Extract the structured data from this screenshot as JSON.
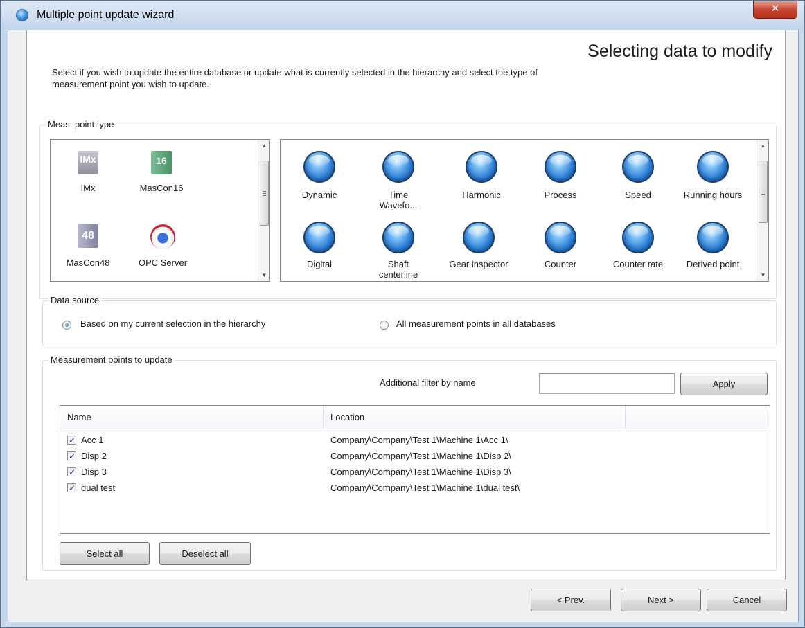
{
  "window": {
    "title": "Multiple point update wizard",
    "close_glyph": "✕"
  },
  "header": {
    "heading": "Selecting data to modify",
    "intro": "Select if you wish to update the entire database or update what is currently selected in the hierarchy and select the type of measurement point you wish to update."
  },
  "meas_point_type": {
    "label": "Meas. point type",
    "devices": [
      {
        "label": "IMx",
        "icon": "imx-icon",
        "glyph": "IMx"
      },
      {
        "label": "MasCon16",
        "icon": "mascon16-icon",
        "glyph": "16"
      },
      {
        "label": "MasCon48",
        "icon": "mascon48-icon",
        "glyph": "48"
      },
      {
        "label": "OPC Server",
        "icon": "opc-server-icon",
        "glyph": ""
      }
    ],
    "types": [
      {
        "label": "Dynamic",
        "icon": "point-orb-icon",
        "selected": true
      },
      {
        "label": "Time Wavefo...",
        "icon": "point-orb-icon"
      },
      {
        "label": "Harmonic",
        "icon": "point-orb-icon"
      },
      {
        "label": "Process",
        "icon": "point-orb-icon"
      },
      {
        "label": "Speed",
        "icon": "point-orb-icon"
      },
      {
        "label": "Running hours",
        "icon": "point-orb-icon"
      },
      {
        "label": "Digital",
        "icon": "point-orb-icon"
      },
      {
        "label": "Shaft centerline",
        "icon": "point-orb-icon"
      },
      {
        "label": "Gear inspector",
        "icon": "point-orb-icon"
      },
      {
        "label": "Counter",
        "icon": "point-orb-icon"
      },
      {
        "label": "Counter rate",
        "icon": "point-orb-icon"
      },
      {
        "label": "Derived point",
        "icon": "point-orb-icon"
      }
    ]
  },
  "data_source": {
    "label": "Data source",
    "options": [
      {
        "label": "Based on my current selection in the hierarchy",
        "checked": true
      },
      {
        "label": "All measurement points in all databases",
        "checked": false
      }
    ]
  },
  "measurement_points": {
    "label": "Measurement points to update",
    "filter_label": "Additional filter by name",
    "filter_value": "",
    "apply_label": "Apply",
    "columns": [
      "Name",
      "Location"
    ],
    "rows": [
      {
        "name": "Acc 1",
        "location": "Company\\Company\\Test 1\\Machine 1\\Acc 1\\",
        "checked": true
      },
      {
        "name": "Disp 2",
        "location": "Company\\Company\\Test 1\\Machine 1\\Disp 2\\",
        "checked": true
      },
      {
        "name": "Disp 3",
        "location": "Company\\Company\\Test 1\\Machine 1\\Disp 3\\",
        "checked": true
      },
      {
        "name": "dual test",
        "location": "Company\\Company\\Test 1\\Machine 1\\dual test\\",
        "checked": true
      }
    ],
    "select_all_label": "Select all",
    "deselect_all_label": "Deselect all"
  },
  "footer": {
    "prev_label": "< Prev.",
    "next_label": "Next >",
    "cancel_label": "Cancel"
  },
  "scroll_glyphs": {
    "up": "▲",
    "down": "▼"
  }
}
